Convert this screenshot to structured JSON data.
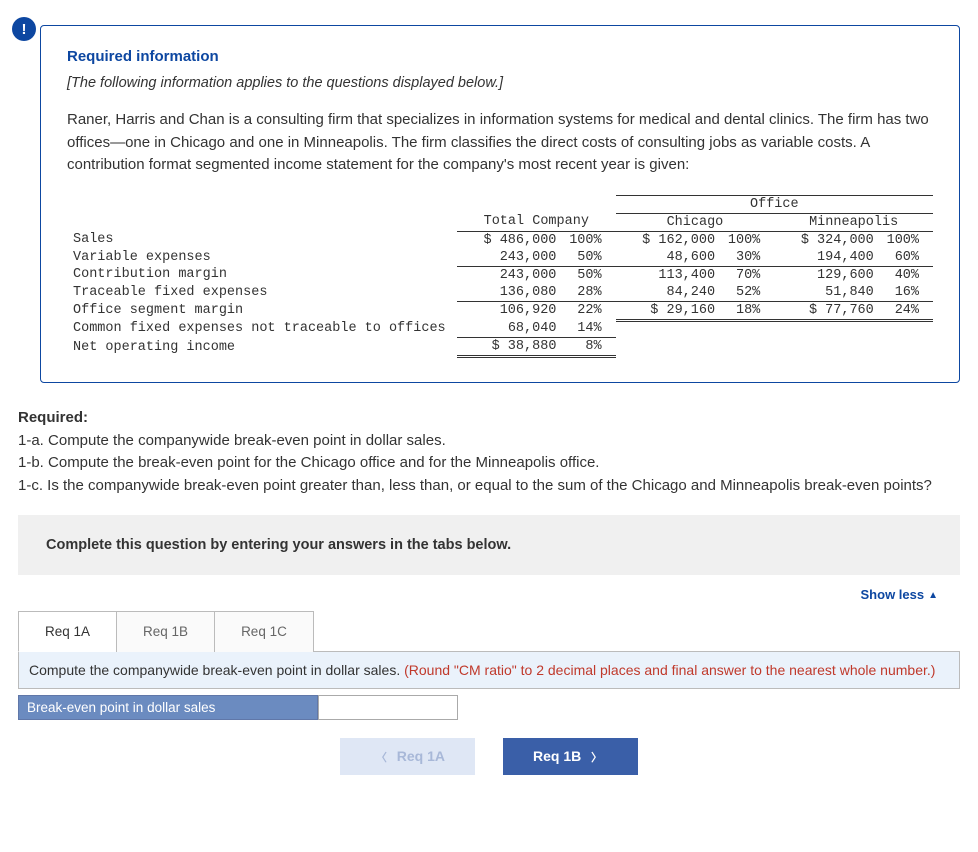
{
  "info_icon_glyph": "!",
  "info_title": "Required information",
  "info_sub": "[The following information applies to the questions displayed below.]",
  "info_body": "Raner, Harris and Chan is a consulting firm that specializes in information systems for medical and dental clinics. The firm has two offices—one in Chicago and one in Minneapolis. The firm classifies the direct costs of consulting jobs as variable costs. A contribution format segmented income statement for the company's most recent year is given:",
  "fin": {
    "office_hdr": "Office",
    "cols": {
      "total": "Total Company",
      "chi": "Chicago",
      "min": "Minneapolis"
    },
    "rows": {
      "sales": {
        "label": "Sales",
        "t_amt": "$ 486,000",
        "t_pct": "100%",
        "c_amt": "$ 162,000",
        "c_pct": "100%",
        "m_amt": "$ 324,000",
        "m_pct": "100%"
      },
      "varexp": {
        "label": "Variable expenses",
        "t_amt": "243,000",
        "t_pct": "50%",
        "c_amt": "48,600",
        "c_pct": "30%",
        "m_amt": "194,400",
        "m_pct": "60%"
      },
      "cm": {
        "label": "Contribution margin",
        "t_amt": "243,000",
        "t_pct": "50%",
        "c_amt": "113,400",
        "c_pct": "70%",
        "m_amt": "129,600",
        "m_pct": "40%"
      },
      "tfe": {
        "label": "Traceable fixed expenses",
        "t_amt": "136,080",
        "t_pct": "28%",
        "c_amt": "84,240",
        "c_pct": "52%",
        "m_amt": "51,840",
        "m_pct": "16%"
      },
      "osm": {
        "label": "Office segment margin",
        "t_amt": "106,920",
        "t_pct": "22%",
        "c_amt": "$ 29,160",
        "c_pct": "18%",
        "m_amt": "$ 77,760",
        "m_pct": "24%"
      },
      "cfe": {
        "label": "Common fixed expenses not traceable to offices",
        "t_amt": "68,040",
        "t_pct": "14%"
      },
      "noi": {
        "label": "Net operating income",
        "t_amt": "$ 38,880",
        "t_pct": "8%"
      }
    }
  },
  "required": {
    "heading": "Required:",
    "a": "1-a. Compute the companywide break-even point in dollar sales.",
    "b": "1-b. Compute the break-even point for the Chicago office and for the Minneapolis office.",
    "c": "1-c. Is the companywide break-even point greater than, less than, or equal to the sum of the Chicago and Minneapolis break-even points?"
  },
  "instruction": "Complete this question by entering your answers in the tabs below.",
  "showless": "Show less",
  "tabs": {
    "a": "Req 1A",
    "b": "Req 1B",
    "c": "Req 1C"
  },
  "tab_content": {
    "prompt_main": "Compute the companywide break-even point in dollar sales. ",
    "prompt_hint": "(Round \"CM ratio\" to 2 decimal places and final answer to the nearest whole number.)",
    "input_label": "Break-even point in dollar sales",
    "input_value": ""
  },
  "nav": {
    "prev": "Req 1A",
    "next": "Req 1B"
  }
}
